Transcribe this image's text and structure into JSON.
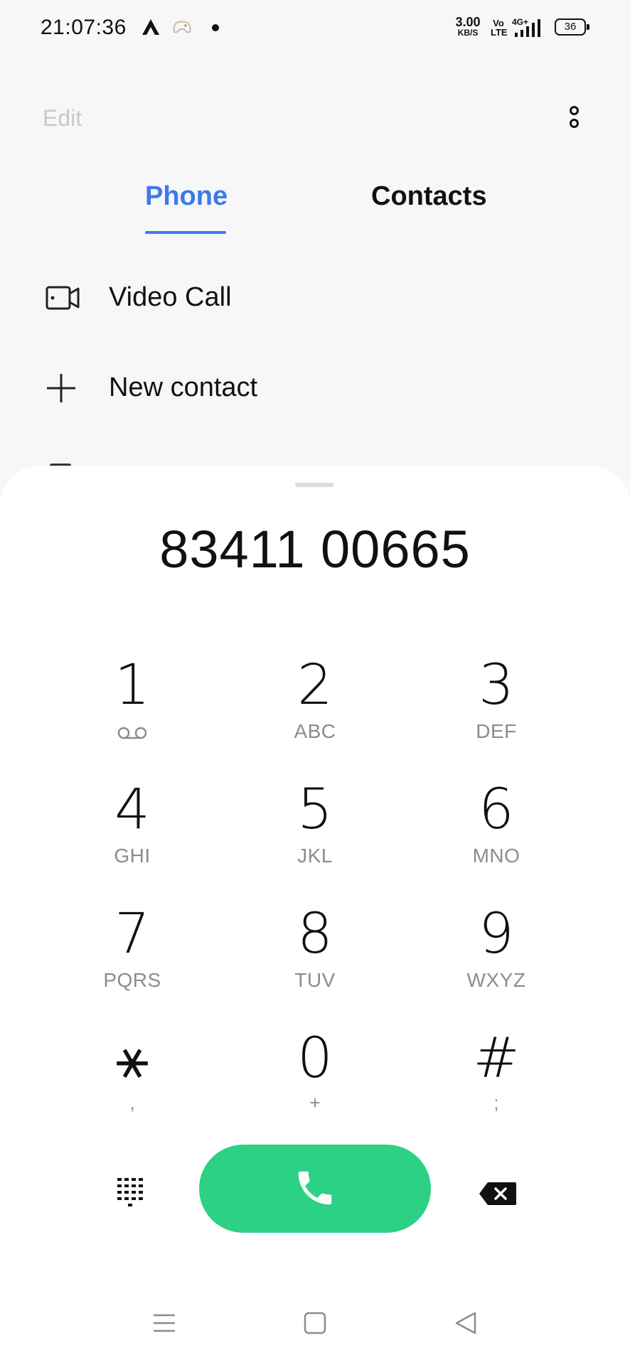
{
  "status_bar": {
    "time": "21:07:36",
    "net_speed_value": "3.00",
    "net_speed_unit": "KB/S",
    "volte_top": "Vo",
    "volte_bottom": "LTE",
    "network": "4G+",
    "battery": "36",
    "icons": [
      "notification-a-icon",
      "game-controller-icon",
      "dot-icon",
      "signal-icon",
      "battery-icon"
    ]
  },
  "top_bar": {
    "edit_label": "Edit",
    "more_icon": "more-vertical-icon"
  },
  "tabs": [
    {
      "label": "Phone",
      "active": true
    },
    {
      "label": "Contacts",
      "active": false
    }
  ],
  "list": {
    "items": [
      {
        "label": "Video Call",
        "icon": "video-call-icon"
      },
      {
        "label": "New contact",
        "icon": "plus-icon"
      }
    ]
  },
  "dialer": {
    "number": "83411 00665",
    "keys": [
      {
        "digit": "1",
        "letters": "",
        "icon": "voicemail-icon"
      },
      {
        "digit": "2",
        "letters": "ABC"
      },
      {
        "digit": "3",
        "letters": "DEF"
      },
      {
        "digit": "4",
        "letters": "GHI"
      },
      {
        "digit": "5",
        "letters": "JKL"
      },
      {
        "digit": "6",
        "letters": "MNO"
      },
      {
        "digit": "7",
        "letters": "PQRS"
      },
      {
        "digit": "8",
        "letters": "TUV"
      },
      {
        "digit": "9",
        "letters": "WXYZ"
      },
      {
        "digit": "⚹",
        "letters": ","
      },
      {
        "digit": "0",
        "letters": "+"
      },
      {
        "digit": "#",
        "letters": ";"
      }
    ],
    "actions": {
      "dialpad_icon": "dialpad-icon",
      "call_icon": "phone-icon",
      "backspace_icon": "backspace-icon"
    },
    "colors": {
      "accent": "#3a7be9",
      "call_green": "#2cd184",
      "letters_gray": "#8c8c90"
    }
  },
  "nav_bar": {
    "icons": [
      "menu-icon",
      "home-icon",
      "back-icon"
    ]
  }
}
